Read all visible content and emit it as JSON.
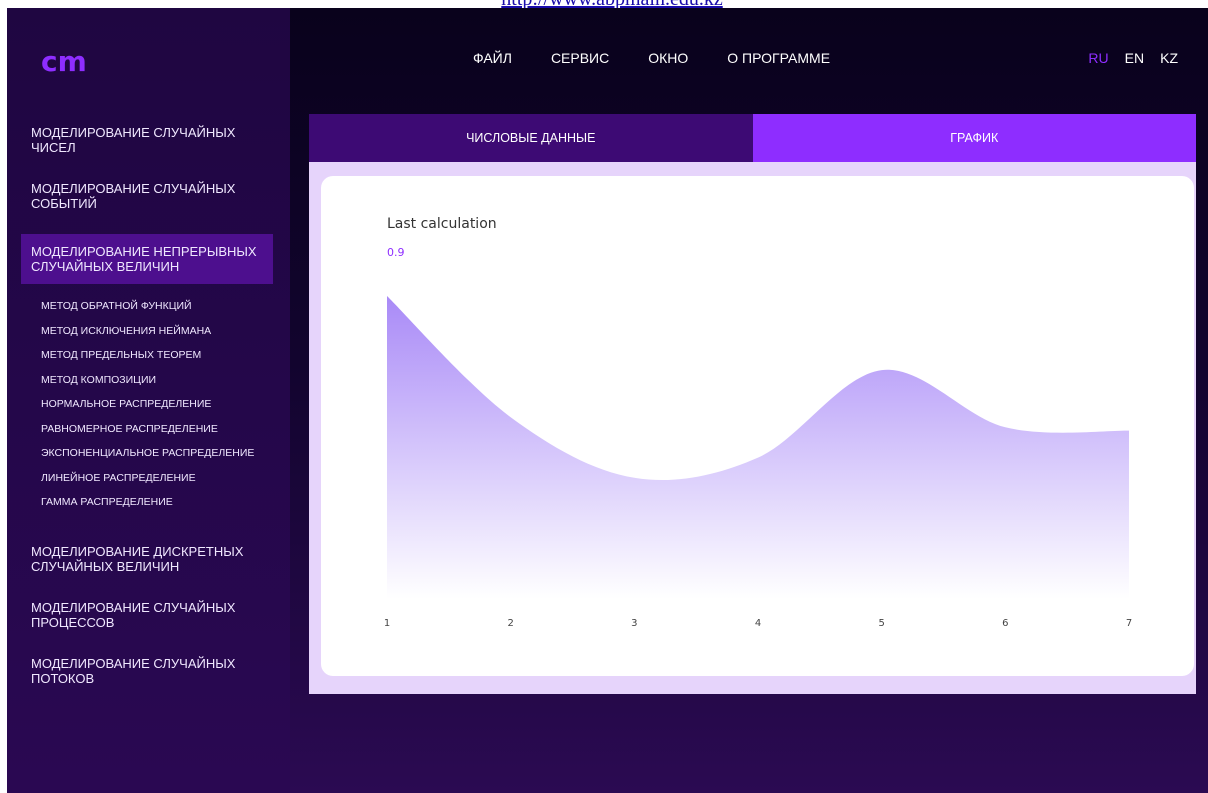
{
  "top_link": "http://www.abpmain.edu.kz",
  "logo": "cm",
  "menu": [
    "ФАЙЛ",
    "СЕРВИС",
    "ОКНО",
    "О ПРОГРАММЕ"
  ],
  "languages": [
    {
      "label": "RU",
      "active": true
    },
    {
      "label": "EN",
      "active": false
    },
    {
      "label": "KZ",
      "active": false
    }
  ],
  "sidebar": {
    "items": [
      {
        "label": "МОДЕЛИРОВАНИЕ СЛУЧАЙНЫХ ЧИСЕЛ"
      },
      {
        "label": "МОДЕЛИРОВАНИЕ СЛУЧАЙНЫХ СОБЫТИЙ"
      },
      {
        "label": "МОДЕЛИРОВАНИЕ НЕПРЕРЫВНЫХ СЛУЧАЙНЫХ ВЕЛИЧИН",
        "active": true
      },
      {
        "label": "МОДЕЛИРОВАНИЕ ДИСКРЕТНЫХ СЛУЧАЙНЫХ ВЕЛИЧИН"
      },
      {
        "label": "МОДЕЛИРОВАНИЕ СЛУЧАЙНЫХ ПРОЦЕССОВ"
      },
      {
        "label": "МОДЕЛИРОВАНИЕ СЛУЧАЙНЫХ ПОТОКОВ"
      }
    ],
    "subitems": [
      "МЕТОД ОБРАТНОЙ ФУНКЦИЙ",
      "МЕТОД ИСКЛЮЧЕНИЯ НЕЙМАНА",
      "МЕТОД ПРЕДЕЛЬНЫХ ТЕОРЕМ",
      "МЕТОД КОМПОЗИЦИИ",
      "НОРМАЛЬНОЕ РАСПРЕДЕЛЕНИЕ",
      "РАВНОМЕРНОЕ РАСПРЕДЕЛЕНИЕ",
      "ЭКСПОНЕНЦИАЛЬНОЕ РАСПРЕДЕЛЕНИЕ",
      "ЛИНЕЙНОЕ РАСПРЕДЕЛЕНИЕ",
      "ГАММА РАСПРЕДЕЛЕНИЕ"
    ]
  },
  "tabs": [
    {
      "label": "ЧИСЛОВЫЕ ДАННЫЕ",
      "active": false
    },
    {
      "label": "ГРАФИК",
      "active": true
    }
  ],
  "colors": {
    "accent": "#8e2dff",
    "area_top": "#a98af7",
    "area_bottom": "#ffffff"
  },
  "chart_data": {
    "type": "area",
    "title": "Last calculation",
    "highlight_value": "0.9",
    "x": [
      1,
      2,
      3,
      4,
      5,
      6,
      7
    ],
    "series": [
      {
        "values": [
          0.9,
          0.54,
          0.36,
          0.42,
          0.68,
          0.51,
          0.5
        ]
      }
    ],
    "ylim": [
      0,
      0.9
    ],
    "grid": false
  }
}
